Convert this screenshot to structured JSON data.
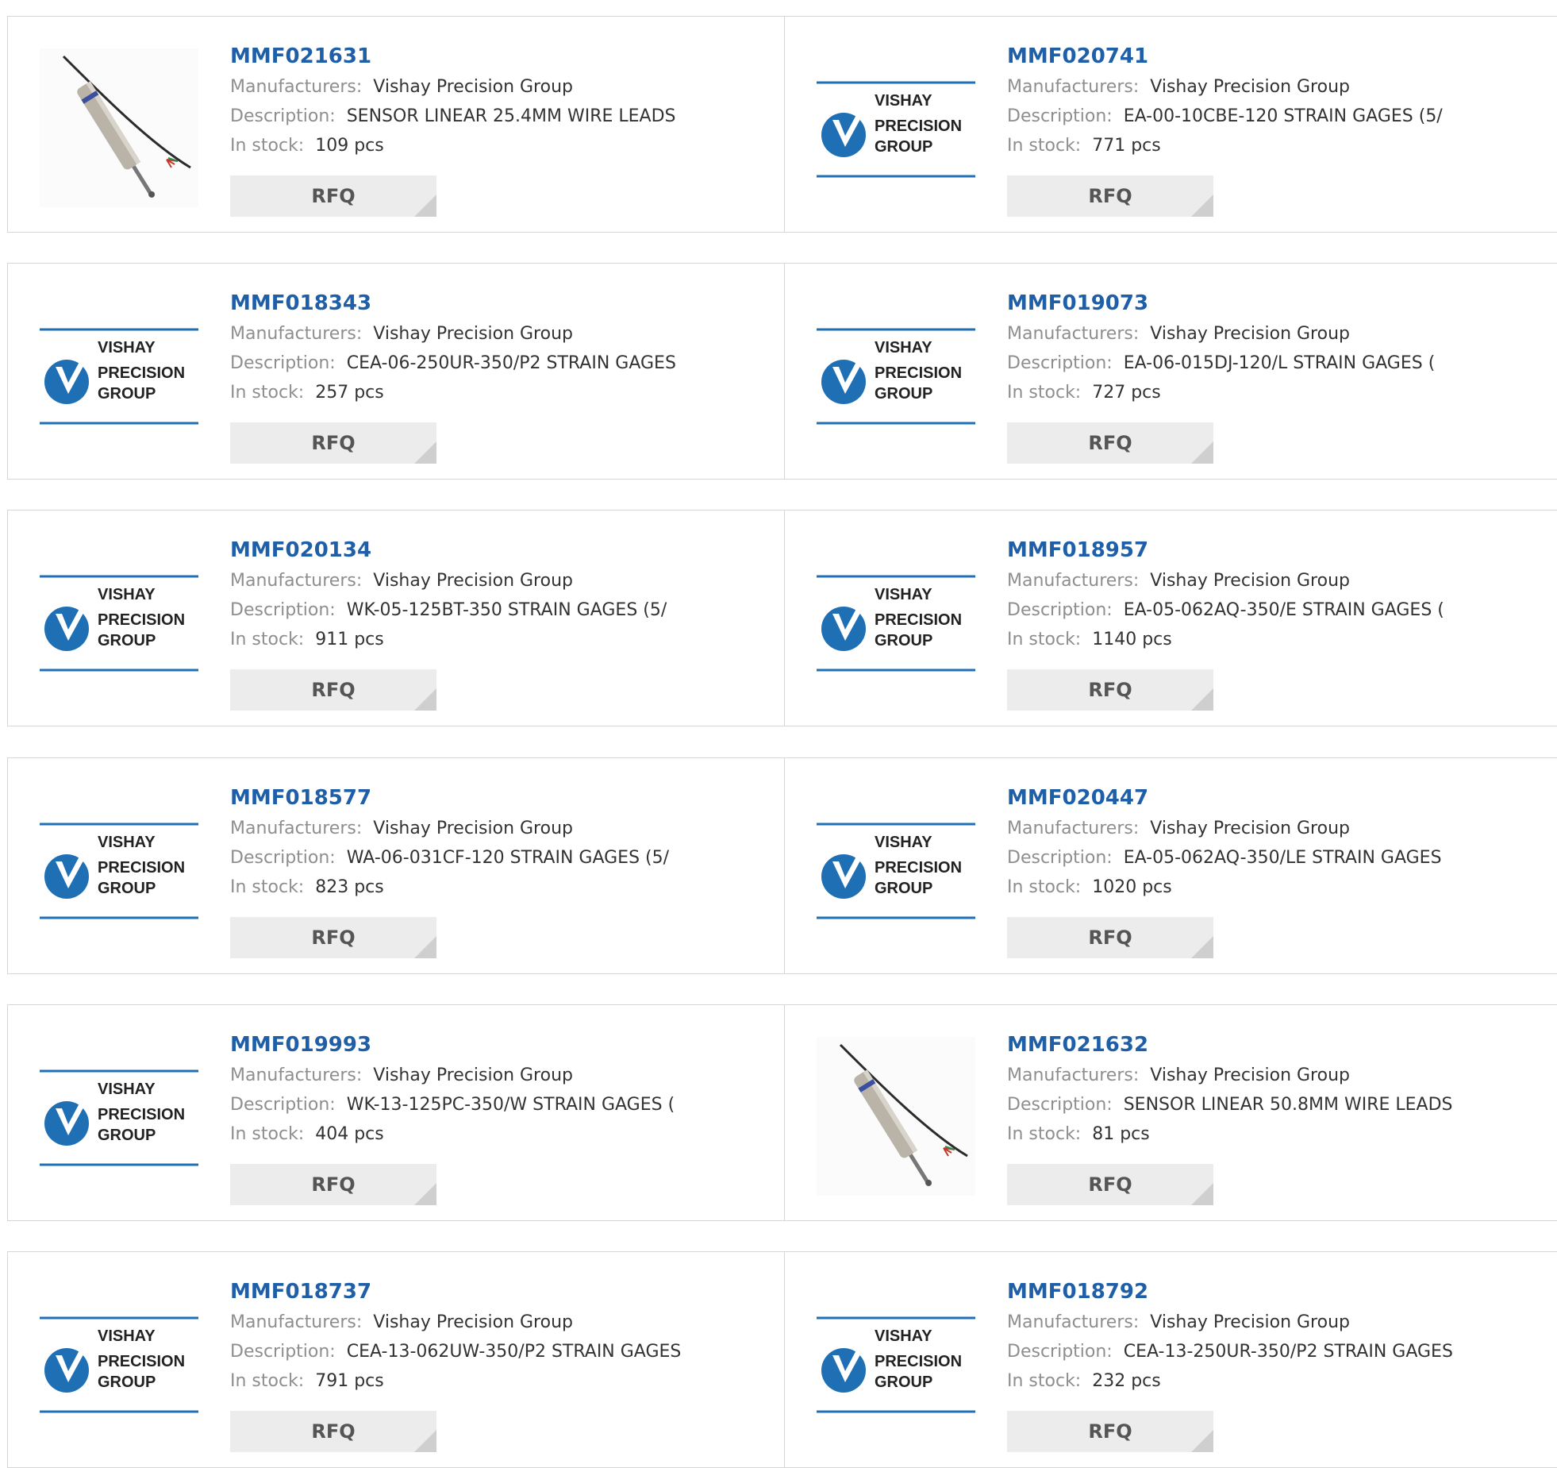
{
  "labels": {
    "manufacturers": "Manufacturers:",
    "description": "Description:",
    "in_stock": "In stock:",
    "rfq": "RFQ"
  },
  "logo": {
    "line1": "VISHAY",
    "line2": "PRECISION",
    "line3": "GROUP",
    "brand_blue": "#1f6fb5"
  },
  "products": [
    {
      "pn": "MMF021631",
      "manufacturer": "Vishay Precision Group",
      "description": "SENSOR LINEAR 25.4MM WIRE LEADS",
      "stock": "109 pcs",
      "image": "sensor-photo"
    },
    {
      "pn": "MMF020741",
      "manufacturer": "Vishay Precision Group",
      "description": "EA-00-10CBE-120 STRAIN GAGES (5/",
      "stock": "771 pcs",
      "image": "vishay-logo"
    },
    {
      "pn": "MMF018343",
      "manufacturer": "Vishay Precision Group",
      "description": "CEA-06-250UR-350/P2 STRAIN GAGES",
      "stock": "257 pcs",
      "image": "vishay-logo"
    },
    {
      "pn": "MMF019073",
      "manufacturer": "Vishay Precision Group",
      "description": "EA-06-015DJ-120/L STRAIN GAGES (",
      "stock": "727 pcs",
      "image": "vishay-logo"
    },
    {
      "pn": "MMF020134",
      "manufacturer": "Vishay Precision Group",
      "description": "WK-05-125BT-350 STRAIN GAGES (5/",
      "stock": "911 pcs",
      "image": "vishay-logo"
    },
    {
      "pn": "MMF018957",
      "manufacturer": "Vishay Precision Group",
      "description": "EA-05-062AQ-350/E STRAIN GAGES (",
      "stock": "1140 pcs",
      "image": "vishay-logo"
    },
    {
      "pn": "MMF018577",
      "manufacturer": "Vishay Precision Group",
      "description": "WA-06-031CF-120 STRAIN GAGES (5/",
      "stock": "823 pcs",
      "image": "vishay-logo"
    },
    {
      "pn": "MMF020447",
      "manufacturer": "Vishay Precision Group",
      "description": "EA-05-062AQ-350/LE STRAIN GAGES",
      "stock": "1020 pcs",
      "image": "vishay-logo"
    },
    {
      "pn": "MMF019993",
      "manufacturer": "Vishay Precision Group",
      "description": "WK-13-125PC-350/W STRAIN GAGES (",
      "stock": "404 pcs",
      "image": "vishay-logo"
    },
    {
      "pn": "MMF021632",
      "manufacturer": "Vishay Precision Group",
      "description": "SENSOR LINEAR 50.8MM WIRE LEADS",
      "stock": "81 pcs",
      "image": "sensor-photo"
    },
    {
      "pn": "MMF018737",
      "manufacturer": "Vishay Precision Group",
      "description": "CEA-13-062UW-350/P2 STRAIN GAGES",
      "stock": "791 pcs",
      "image": "vishay-logo"
    },
    {
      "pn": "MMF018792",
      "manufacturer": "Vishay Precision Group",
      "description": "CEA-13-250UR-350/P2 STRAIN GAGES",
      "stock": "232 pcs",
      "image": "vishay-logo"
    }
  ]
}
